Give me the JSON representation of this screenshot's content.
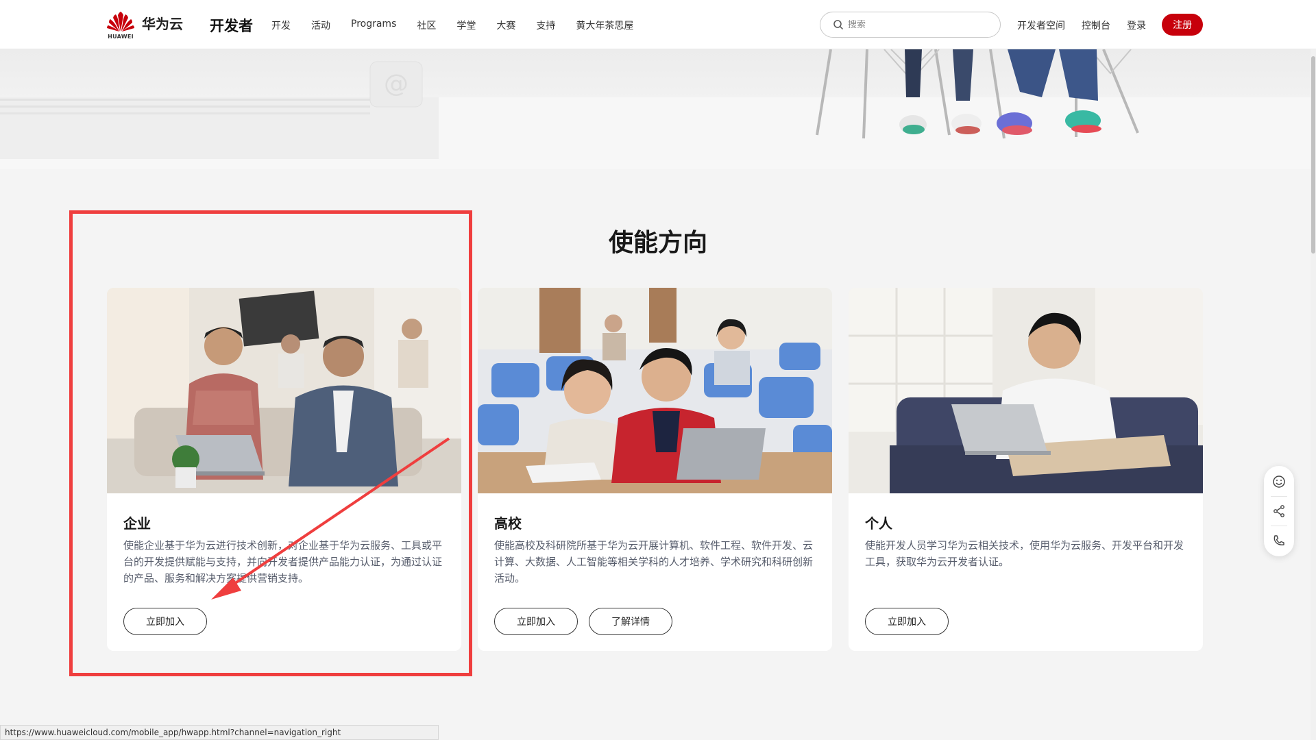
{
  "header": {
    "logo_caption": "HUAWEI",
    "brand": "华为云",
    "section": "开发者",
    "nav": [
      "开发",
      "活动",
      "Programs",
      "社区",
      "学堂",
      "大赛",
      "支持",
      "黄大年茶思屋"
    ],
    "search_placeholder": "搜索",
    "links": [
      "开发者空间",
      "控制台",
      "登录"
    ],
    "register": "注册",
    "accent_color": "#c7000b"
  },
  "section": {
    "title": "使能方向"
  },
  "cards": [
    {
      "title": "企业",
      "description": "使能企业基于华为云进行技术创新，对企业基于华为云服务、工具或平台的开发提供赋能与支持，并向开发者提供产品能力认证，为通过认证的产品、服务和解决方案提供营销支持。",
      "buttons": [
        "立即加入"
      ]
    },
    {
      "title": "高校",
      "description": "使能高校及科研院所基于华为云开展计算机、软件工程、软件开发、云计算、大数据、人工智能等相关学科的人才培养、学术研究和科研创新活动。",
      "buttons": [
        "立即加入",
        "了解详情"
      ]
    },
    {
      "title": "个人",
      "description": "使能开发人员学习华为云相关技术，使用华为云服务、开发平台和开发工具，获取华为云开发者认证。",
      "buttons": [
        "立即加入"
      ]
    }
  ],
  "float_tools": [
    "smile-icon",
    "share-icon",
    "phone-icon"
  ],
  "status_url": "https://www.huaweicloud.com/mobile_app/hwapp.html?channel=navigation_right",
  "annotation_color": "#ef3e3e"
}
